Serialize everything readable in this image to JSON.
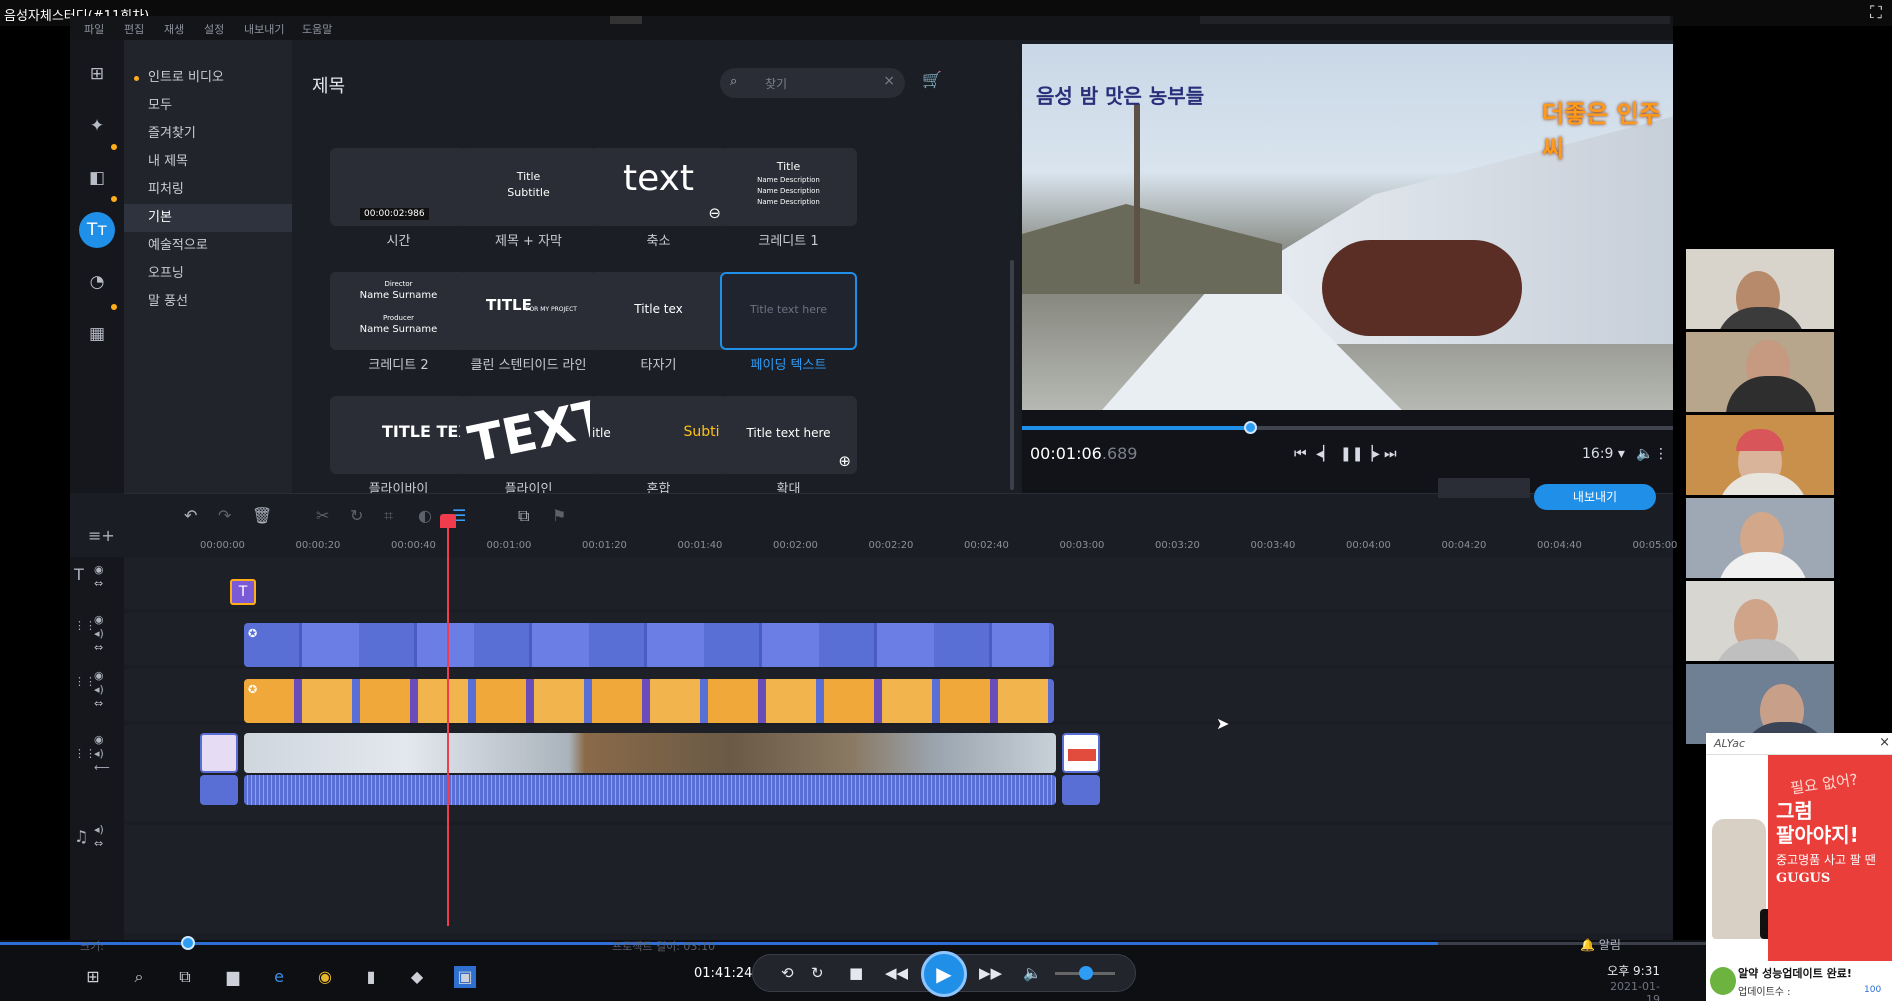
{
  "window": {
    "title": "음성자체스터디(#11회차)"
  },
  "menu": [
    "파일",
    "편집",
    "재생",
    "설정",
    "내보내기",
    "도움말"
  ],
  "rail": [
    "import-icon",
    "magic-wand-icon",
    "transition-icon",
    "titles-icon",
    "clock-icon",
    "grid-icon"
  ],
  "categories": {
    "items": [
      "인트로 비디오",
      "모두",
      "즐겨찾기",
      "내 제목",
      "피처링",
      "기본",
      "예술적으로",
      "오프닝",
      "말 풍선"
    ],
    "selected": "기본"
  },
  "titles": {
    "heading": "제목",
    "search_placeholder": "찾기",
    "tiles": [
      {
        "label": "시간",
        "preview": "00:00:02:986"
      },
      {
        "label": "제목 + 자막",
        "preview_line1": "Title",
        "preview_line2": "Subtitle"
      },
      {
        "label": "축소",
        "preview": "text"
      },
      {
        "label": "크레디트 1",
        "preview_line1": "Title",
        "preview_line2": "Name Description",
        "preview_line3": "Name Description",
        "preview_line4": "Name Description"
      },
      {
        "label": "크레디트 2",
        "preview_line1": "Director",
        "preview_line2": "Name Surname",
        "preview_line3": "Producer",
        "preview_line4": "Name Surname"
      },
      {
        "label": "클린 스텐티이드 라인",
        "preview": "TITLE",
        "preview_small": "FOR MY PROJECT"
      },
      {
        "label": "타자기",
        "preview": "Title tex"
      },
      {
        "label": "페이딩 텍스트",
        "preview": "Title text here"
      },
      {
        "label": "플라이바이",
        "preview": "TITLE TEXT H"
      },
      {
        "label": "플라이인",
        "preview": "TEXT"
      },
      {
        "label": "혼합",
        "preview_left": "itle",
        "preview_right": "Subtit"
      },
      {
        "label": "확대",
        "preview": "Title text here"
      }
    ],
    "selected": "페이딩 텍스트"
  },
  "preview": {
    "timecode": "00:01:06",
    "timecode_frac": ".689",
    "aspect_ratio": "16:9",
    "progress": 0.35,
    "overlay_left": "음성 밤 맛은 농부들",
    "overlay_right": "더좋은 인주씨"
  },
  "export": {
    "label": "내보내기"
  },
  "timeline": {
    "ruler": [
      "00:00:00",
      "00:00:20",
      "00:00:40",
      "00:01:00",
      "00:01:20",
      "00:01:40",
      "00:02:00",
      "00:02:20",
      "00:02:40",
      "00:03:00",
      "00:03:20",
      "00:03:40",
      "00:04:00",
      "00:04:20",
      "00:04:40",
      "00:05:00"
    ],
    "playhead_time": "00:01:06",
    "title_clip_icon": "T"
  },
  "player": {
    "zoom_label": "크기:",
    "project_length": "프로젝트 길이: 03:10",
    "notify": "알림",
    "elapsed": "01:41:24",
    "clock": "오후 9:31",
    "date": "2021-01-19",
    "progress": 0.76
  },
  "ad": {
    "brand": "ALYac",
    "headline1": "필요 없어?",
    "headline2": "그럼",
    "headline3": "팔아야지!",
    "sub": "중고명품 사고 팔 땐",
    "brand2": "GUGUS",
    "footer1": "알약 성능업데이트 완료!",
    "footer2": "업데이트수 :",
    "footer3": "100"
  },
  "colors": {
    "accent": "#1f8fe8",
    "playhead": "#f03c4c",
    "clip": "#5a6fd6",
    "highlight": "#ffae1a"
  }
}
